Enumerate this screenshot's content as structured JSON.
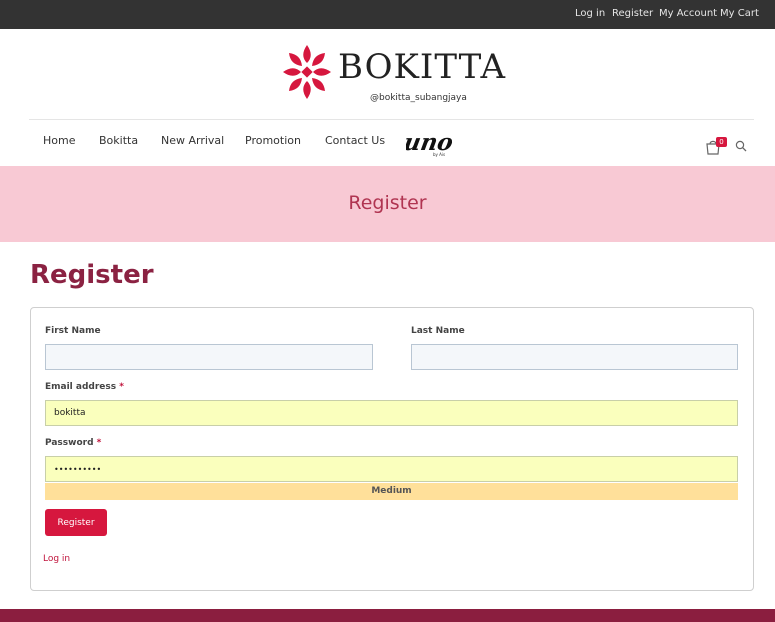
{
  "topbar": {
    "links": [
      "Log in",
      "Register",
      "My Account",
      "My Cart"
    ]
  },
  "brand": {
    "name": "BOKITTA",
    "handle": "@bokitta_subangjaya",
    "logo_color": "#d6173e"
  },
  "nav": {
    "items": [
      "Home",
      "Bokitta",
      "New Arrival",
      "Promotion",
      "Contact Us"
    ],
    "uno_logo": "uno",
    "uno_sub": "by Ais",
    "cart_count": "0",
    "icons": [
      "cart-icon",
      "search-icon"
    ]
  },
  "banner": {
    "title": "Register"
  },
  "page": {
    "title": "Register"
  },
  "form": {
    "first_name_label": "First Name",
    "last_name_label": "Last Name",
    "email_label": "Email address",
    "email_value": "bokitta",
    "password_label": "Password",
    "password_value": "••••••••••",
    "required_mark": "*",
    "strength": "Medium",
    "submit_label": "Register",
    "login_link": "Log in"
  },
  "colors": {
    "accent": "#d6173e",
    "banner": "#f8c9d4",
    "title": "#8b2242",
    "footer": "#8b1e3f",
    "topbar": "#333333"
  }
}
